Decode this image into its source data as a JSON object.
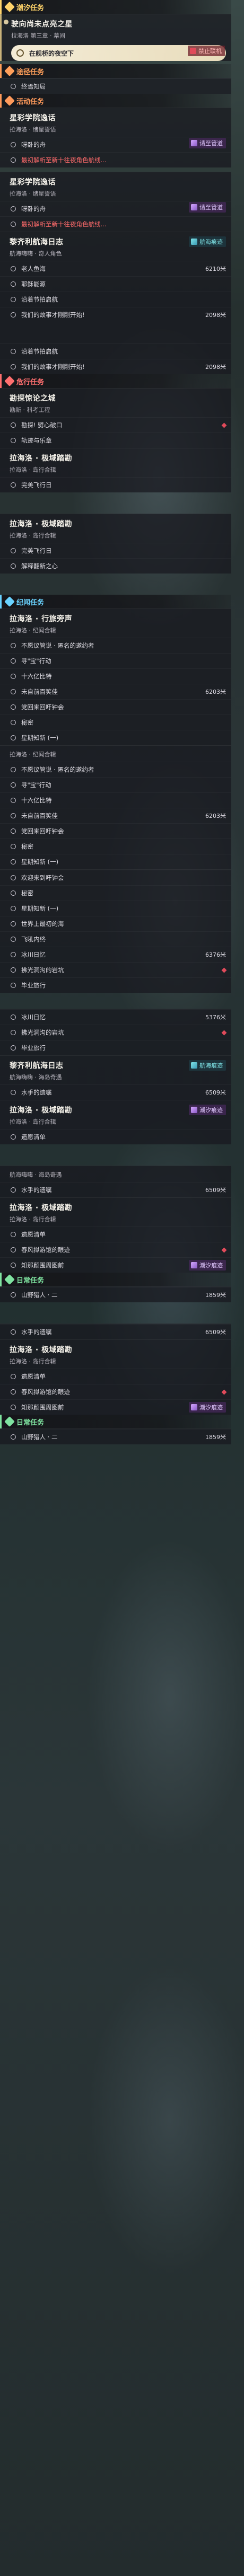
{
  "colors": {
    "tidal": "#ffd36a",
    "trip": "#ff9f5a",
    "activity": "#ff9a5b",
    "danger": "#ff6f6f",
    "chronicle": "#6ad3ff",
    "daily": "#7fe3a0",
    "highlight": "#f4ecd6"
  },
  "categories": {
    "tidal": "潮汐任务",
    "trip": "途径任务",
    "activity": "活动任务",
    "danger": "危行任务",
    "chronicle": "纪闻任务",
    "daily": "日常任务"
  },
  "tags": {
    "forbid": "禁止联机",
    "tidal_trace": "潮汐痕迹",
    "voyage": "航海痕迹",
    "entry": "请至管道"
  },
  "groups": {
    "g1": {
      "title": "驶向尚未点亮之星",
      "sub": "拉海洛 第三章 · 幕间",
      "hl": "在舰桥的夜空下"
    },
    "g2": {
      "obj": "终焉知局"
    },
    "g3": {
      "title": "星彩学院逸话",
      "sub": "拉海洛 · 绪星誓语",
      "obj1": "呀卧的舟",
      "obj2": "最初解析至新十往夜角色航线..."
    },
    "g4": {
      "title": "星彩学院逸话",
      "sub": "拉海洛 · 绪星誓语",
      "obj1": "呀卧的舟",
      "obj2": "最初解析至新十往夜角色航线..."
    },
    "g5": {
      "title": "黎齐利航海日志",
      "sub": "航海嗨嗨 · 奇人角色",
      "o1": "老人鱼海",
      "o1d": "6210米",
      "o2": "耶稣能源",
      "o3": "沿着节拍启航",
      "o4": "我们的故事才刚刚开始!",
      "o4d": "2098米",
      "o5": "沿着节拍启航",
      "o6": "我们的故事才刚刚开始!",
      "o6d": "2098米"
    },
    "g6": {
      "title": "勘探惊论之城",
      "sub": "勘新 · 科考工程",
      "o1": "勘探! 劈心破口",
      "o2": "轨迹与乐章"
    },
    "g7": {
      "title": "拉海洛 · 极域踏勘",
      "sub": "拉海洛 · 岛行合辑",
      "o1": "完美飞行日"
    },
    "g8": {
      "title": "拉海洛 · 极域踏勘",
      "sub": "拉海洛 · 岛行合辑",
      "o1": "完美飞行日",
      "o2": "解释翻新之心"
    },
    "g9": {
      "title": "拉海洛 · 行旅旁声",
      "sub": "拉海洛 · 纪闻合辑",
      "o1": "不愿议管说 · 匿名的邀约者",
      "o2": "寻\"宝\"行动",
      "o3": "十六亿比特",
      "o4": "未自前百笑佳",
      "o4d": "6203米",
      "o5": "党回来回吁钟会",
      "o6": "秘密",
      "o7": "星期知新 (一)"
    },
    "g10": {
      "sub": "拉海洛 · 纪闻合辑",
      "o1": "不愿议管说 · 匿名的邀约者",
      "o2": "寻\"宝\"行动",
      "o3": "十六亿比特",
      "o4": "未自前百笑佳",
      "o4d": "6203米",
      "o5": "党回来回吁钟会",
      "o6": "秘密",
      "o7": "星期知新 (一)"
    },
    "g11": {
      "o1": "欢迎来到吁钟会",
      "o2": "秘密",
      "o3": "星期知新 (一)",
      "o4": "世界上最初的海",
      "o5": "飞吼内终",
      "o6": "冰川日忆",
      "o6d": "6376米",
      "o7": "拂光洞沟的岩坑",
      "o8": "毕业旅行"
    },
    "g12": {
      "o1": "冰川日忆",
      "o1d": "5376米",
      "o2": "拂光洞沟的岩坑",
      "o3": "毕业旅行"
    },
    "g13": {
      "title": "黎齐利航海日志",
      "sub": "航海嗨嗨 · 海岛奇遇",
      "o1": "水手的遗嘱",
      "o1d": "6509米"
    },
    "g14": {
      "title": "拉海洛 · 极域踏勘",
      "sub": "拉海洛 · 岛行合辑",
      "o1": "遗愿清单"
    },
    "g15": {
      "sub": "航海嗨嗨 · 海岛奇遇",
      "o1": "水手的遗嘱",
      "o1d": "6509米"
    },
    "g16": {
      "title": "拉海洛 · 极域踏勘",
      "sub": "拉海洛 · 岛行合辑",
      "o1": "遗愿清单",
      "o2": "春风拟游馆的眼迹",
      "o3": "知那颜围周图前"
    },
    "g17": {
      "obj": "山野猎人 · 二",
      "d": "1859米"
    },
    "g18": {
      "o1": "水手的遗嘱",
      "o1d": "6509米"
    },
    "g19": {
      "title": "拉海洛 · 极域踏勘",
      "sub": "拉海洛 · 岛行合辑",
      "o1": "遗愿清单",
      "o2": "春风拟游馆的眼迹",
      "o3": "知那颜围周图前"
    },
    "g20": {
      "obj": "山野猎人 · 二",
      "d": "1859米"
    }
  }
}
